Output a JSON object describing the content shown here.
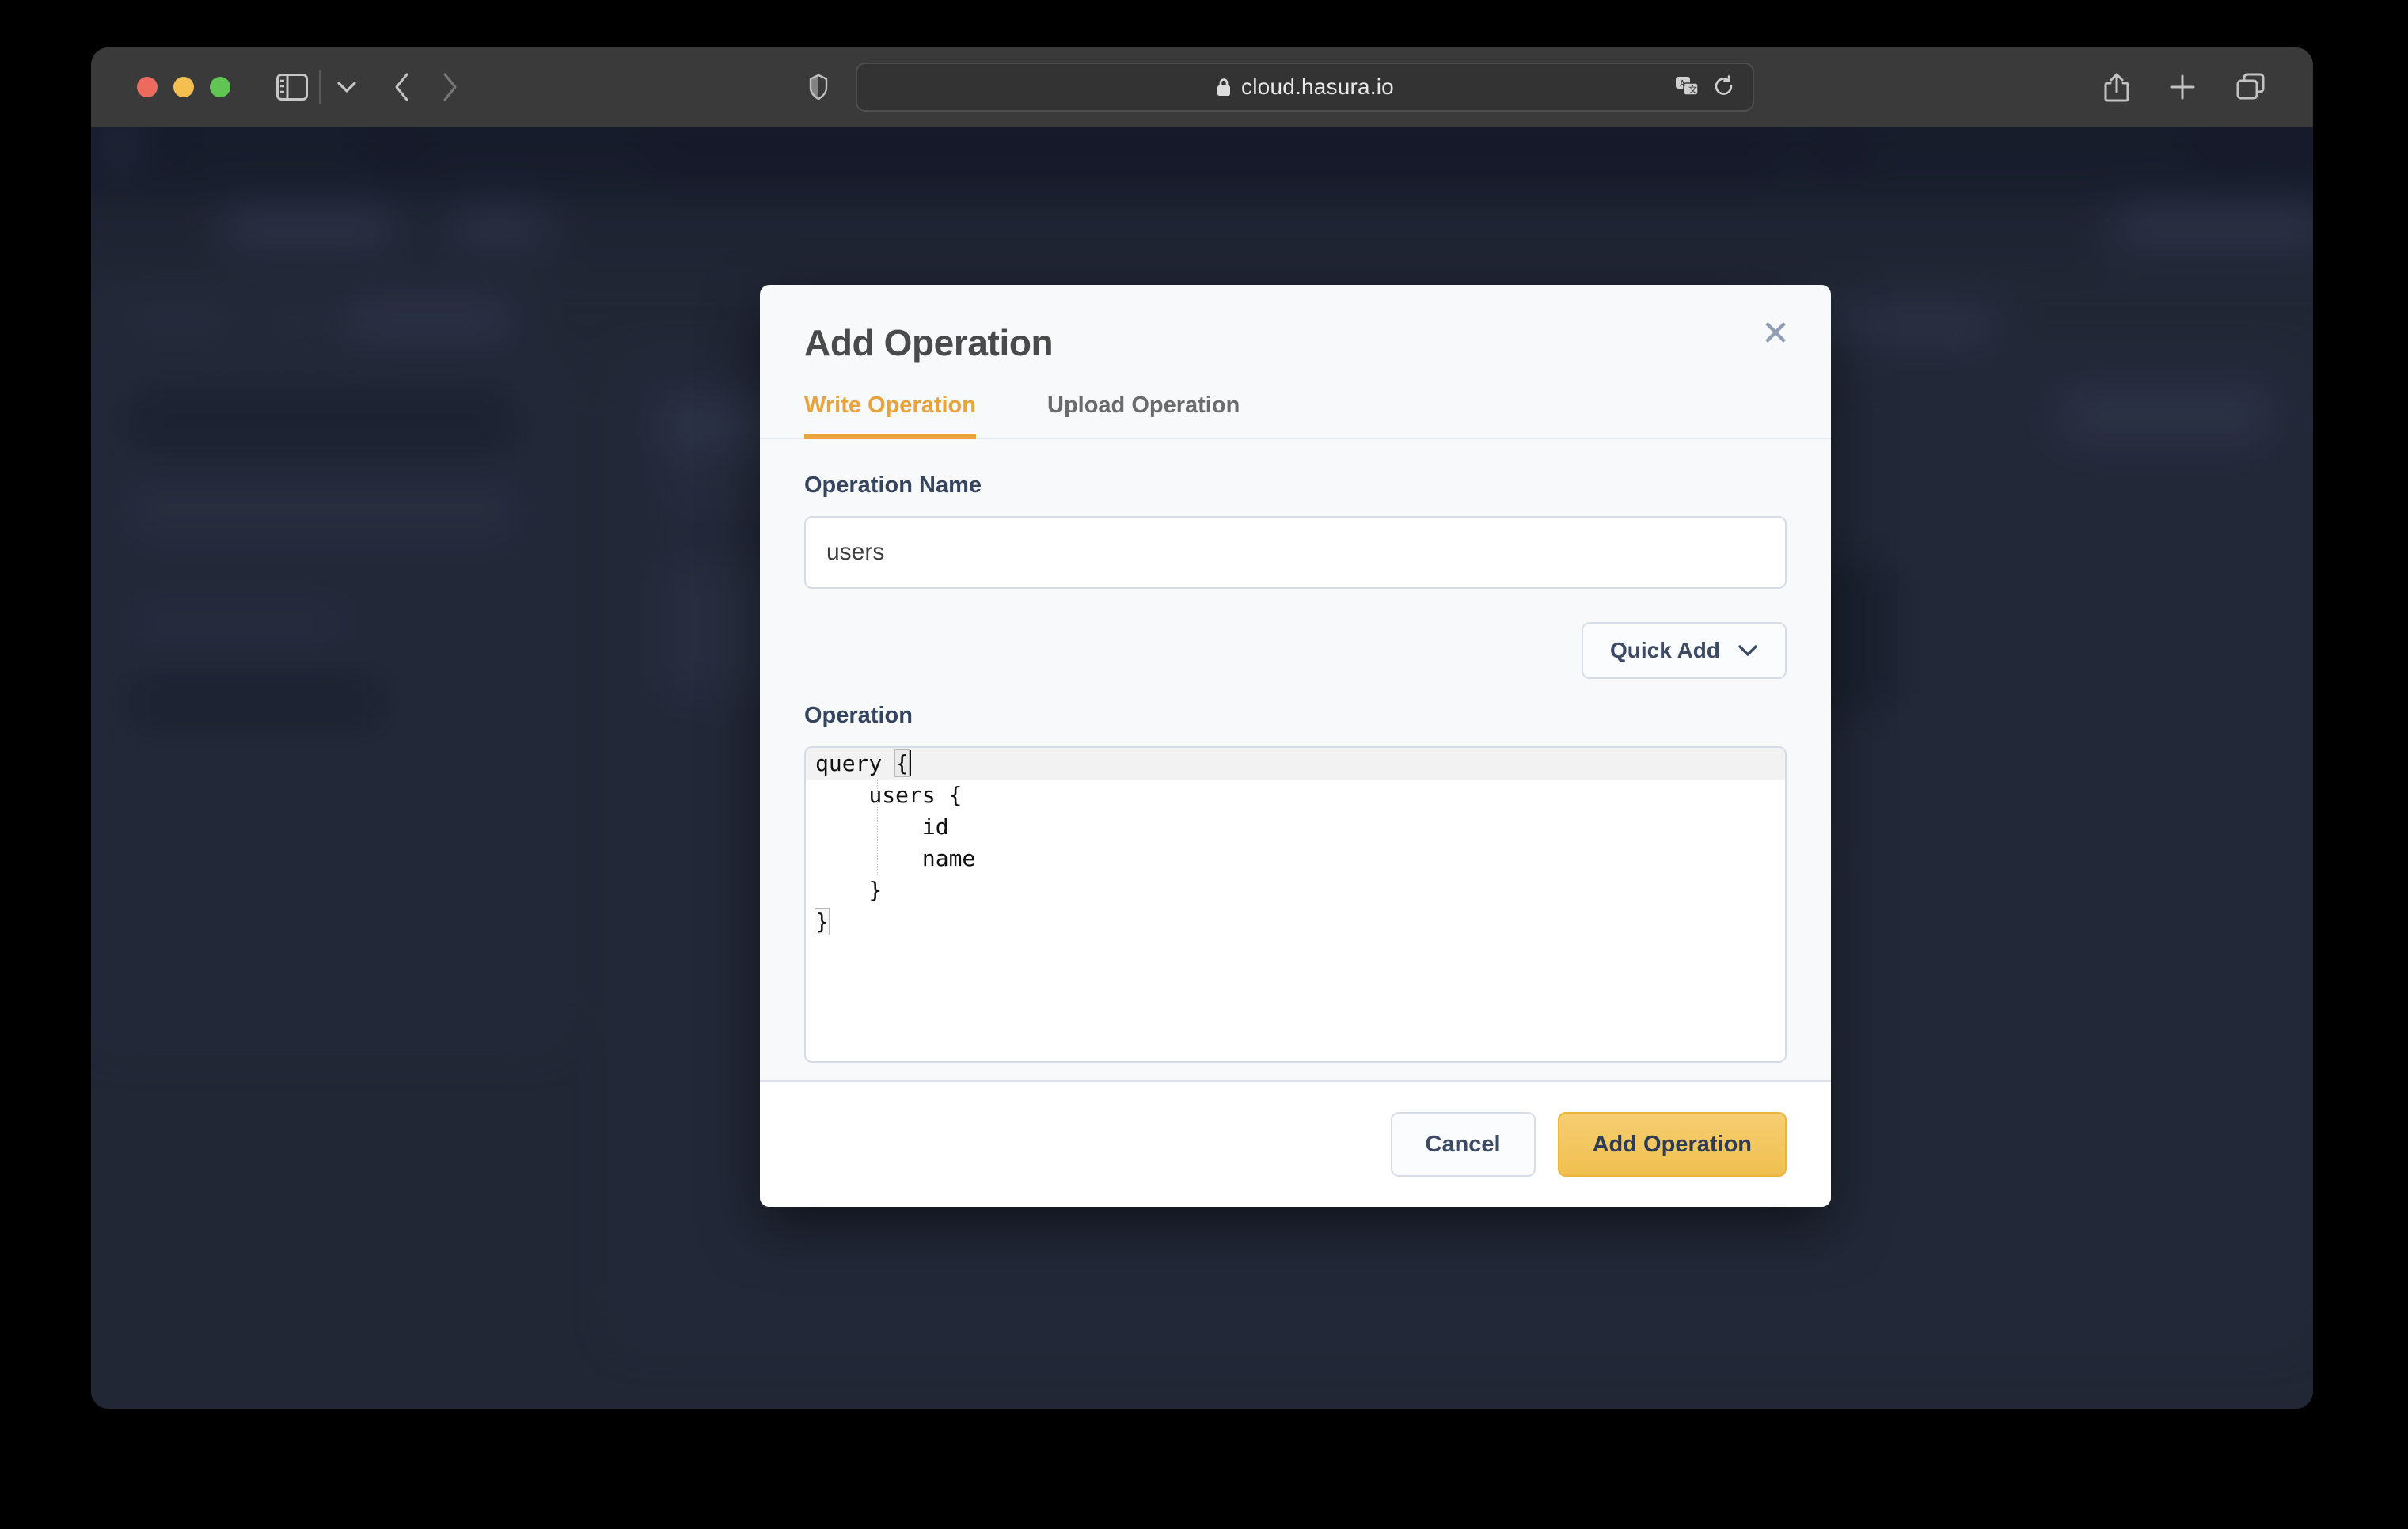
{
  "browser": {
    "url": "cloud.hasura.io",
    "lock_icon": "lock-icon",
    "traffic_lights": [
      "close-red",
      "minimize-yellow",
      "maximize-green"
    ],
    "toolbar_icons": {
      "sidebar": "sidebar-toggle-icon",
      "tab_group_chevron": "chevron-down-icon",
      "back": "back-arrow-icon",
      "forward": "forward-arrow-icon",
      "shield": "privacy-shield-icon",
      "translate": "translate-icon",
      "reload": "reload-icon",
      "share": "share-icon",
      "new_tab": "plus-icon",
      "tab_overview": "tab-overview-icon"
    }
  },
  "modal": {
    "title": "Add Operation",
    "close_label": "✕",
    "tabs": [
      {
        "label": "Write Operation",
        "active": true
      },
      {
        "label": "Upload Operation",
        "active": false
      }
    ],
    "operation_name": {
      "label": "Operation Name",
      "value": "users",
      "placeholder": "Operation Name"
    },
    "quick_add": {
      "label": "Quick Add",
      "chevron": "chevron-down-icon"
    },
    "operation": {
      "label": "Operation",
      "code_lines": [
        "query {",
        "    users {",
        "        id",
        "        name",
        "    }",
        "}"
      ],
      "active_line_index": 0
    },
    "footer": {
      "cancel_label": "Cancel",
      "submit_label": "Add Operation"
    }
  },
  "colors": {
    "accent_orange": "#e8a33d",
    "primary_button": "#f0c04f",
    "navy_text": "#36455f",
    "page_background": "#252b3b",
    "modal_background": "#f8f9fb"
  }
}
